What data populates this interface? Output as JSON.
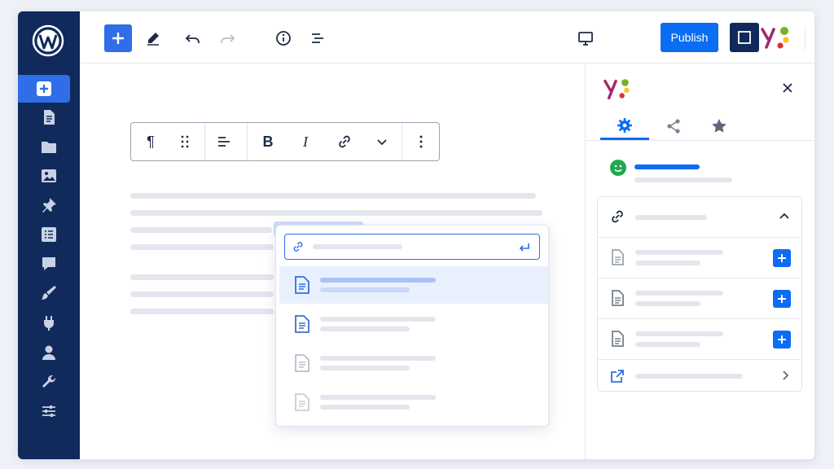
{
  "toolbar": {
    "publish_label": "Publish"
  },
  "block_toolbar": {
    "bold_label": "B",
    "italic_label": "I",
    "paragraph_label": "¶"
  },
  "colors": {
    "accent": "#0b6cf4",
    "sidebar": "#102a5c",
    "highlight": "#e9f0fd",
    "success": "#1ea94f"
  }
}
